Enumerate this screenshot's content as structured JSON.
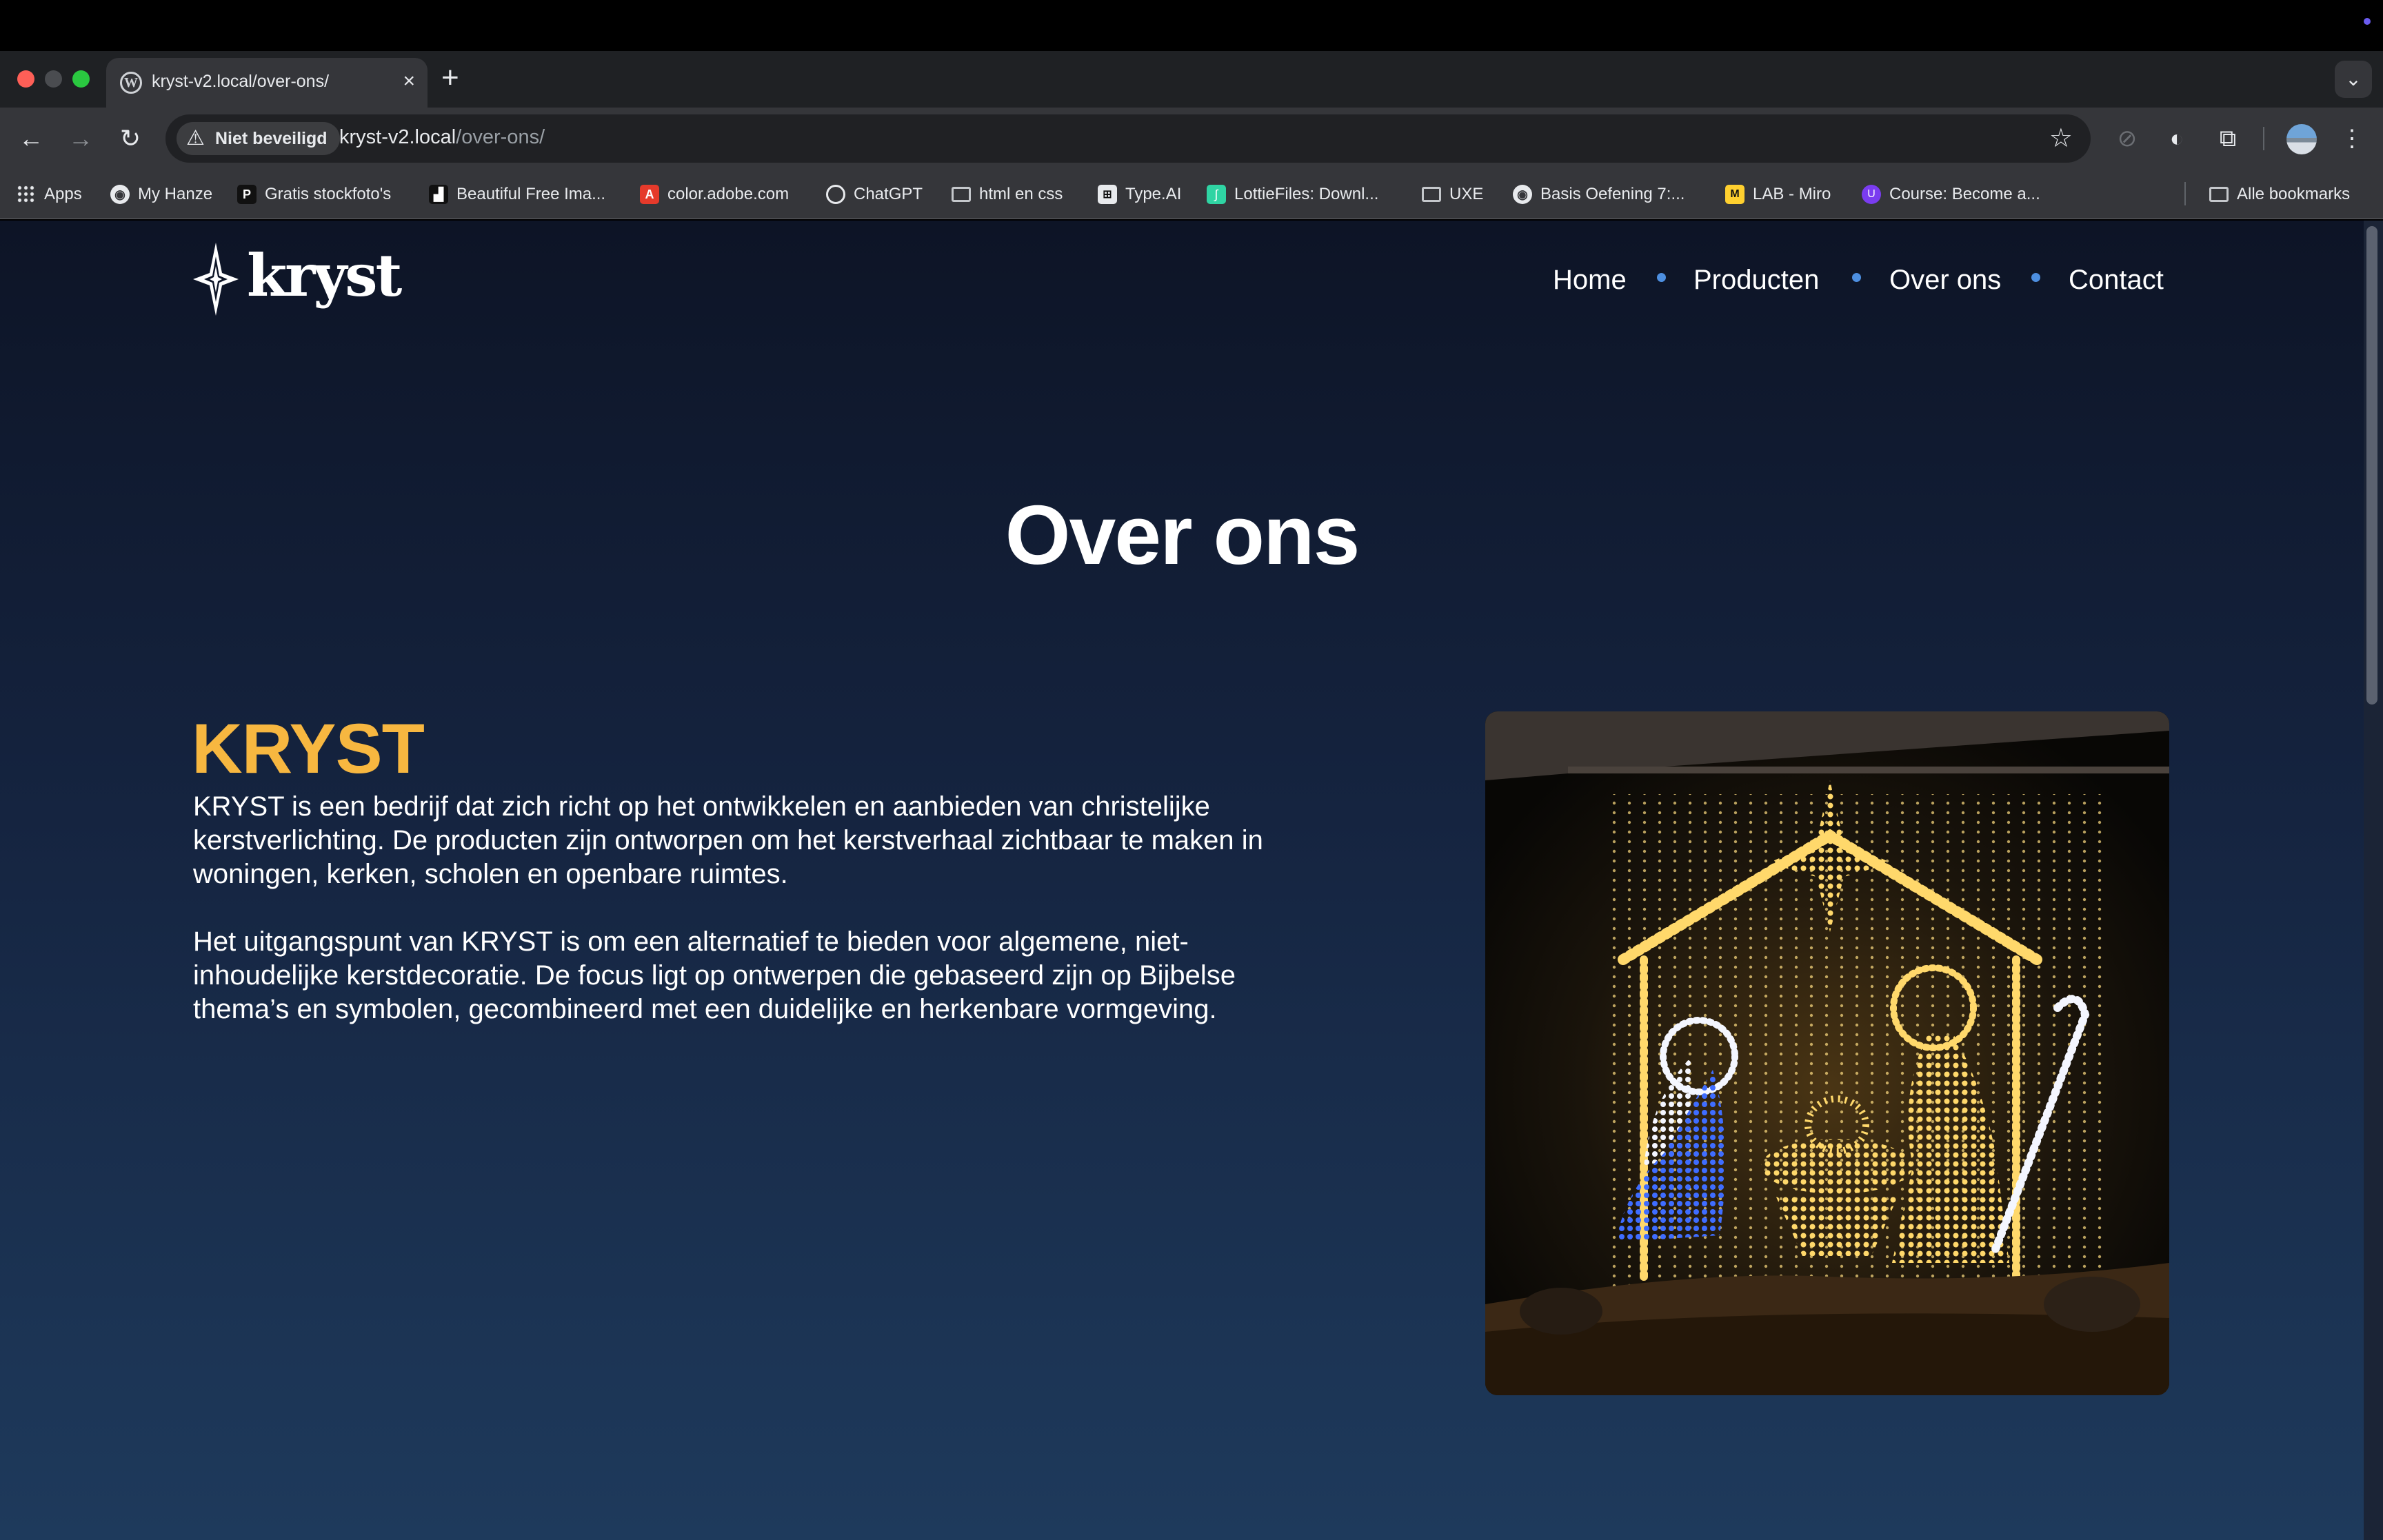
{
  "browser": {
    "tab": {
      "title": "kryst-v2.local/over-ons/",
      "favicon": "wordpress-icon",
      "close": "×"
    },
    "new_tab": "+",
    "tab_search": "⌄",
    "security_label": "Niet beveiligd",
    "url_host": "kryst-v2.local",
    "url_path": "/over-ons/",
    "bookmarks": [
      {
        "label": "Apps",
        "icon": "apps-grid-icon"
      },
      {
        "label": "My Hanze",
        "icon": "globe-icon"
      },
      {
        "label": "Gratis stockfoto's",
        "icon": "pexels-icon"
      },
      {
        "label": "Beautiful Free Ima...",
        "icon": "unsplash-icon"
      },
      {
        "label": "color.adobe.com",
        "icon": "adobe-icon"
      },
      {
        "label": "ChatGPT",
        "icon": "chatgpt-icon"
      },
      {
        "label": "html en css",
        "icon": "folder-icon"
      },
      {
        "label": "Type.AI",
        "icon": "typeai-icon"
      },
      {
        "label": "LottieFiles: Downl...",
        "icon": "lottiefiles-icon"
      },
      {
        "label": "UXE",
        "icon": "folder-icon"
      },
      {
        "label": "Basis Oefening 7:...",
        "icon": "globe-icon"
      },
      {
        "label": "LAB - Miro",
        "icon": "miro-icon"
      },
      {
        "label": "Course: Become a...",
        "icon": "course-icon"
      }
    ],
    "all_bookmarks": "Alle bookmarks"
  },
  "site": {
    "logo_text": "kryst",
    "nav": [
      "Home",
      "Producten",
      "Over ons",
      "Contact"
    ],
    "page_title": "Over ons",
    "brand_heading": "KRYST",
    "paragraph_1": "KRYST is een bedrijf dat zich richt op het ontwikkelen en aanbieden van christelijke kerstverlichting. De producten zijn ontworpen om het kerstverhaal zichtbaar te maken in woningen, kerken, scholen en openbare ruimtes.",
    "paragraph_2": "Het uitgangspunt van KRYST is om een alternatief te bieden voor algemene, niet-inhoudelijke kerstdecoratie. De focus ligt op ontwerpen die gebaseerd zijn op Bijbelse thema’s en symbolen, gecombineerd met een duidelijke en herkenbare vormgeving.",
    "colors": {
      "accent": "#f7b740",
      "nav_dot": "#4d8fe0",
      "bg_top": "#0d1426",
      "bg_bottom": "#1e3a5c"
    }
  }
}
